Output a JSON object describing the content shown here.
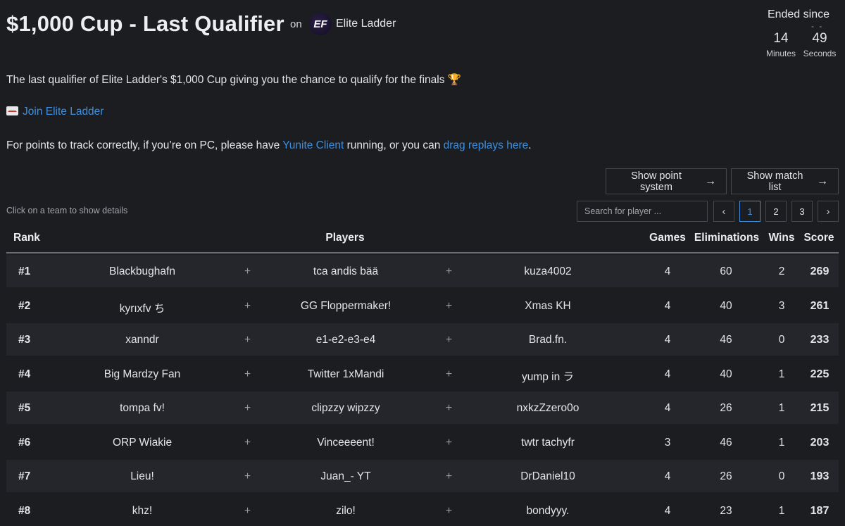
{
  "header": {
    "title": "$1,000 Cup - Last Qualifier",
    "on_label": "on",
    "org_logo_text": "EF",
    "org_name": "Elite Ladder"
  },
  "timer": {
    "label": "Ended since",
    "dash": "- -",
    "minutes": "14",
    "minutes_label": "Minutes",
    "seconds": "49",
    "seconds_label": "Seconds"
  },
  "description": "The last qualifier of Elite Ladder's $1,000 Cup giving you the chance to qualify for the finals 🏆",
  "join_link": "Join Elite Ladder",
  "points_note": {
    "before": "For points to track correctly, if you’re on PC, please have ",
    "client_link": "Yunite Client",
    "middle": " running, or you can ",
    "replays_link": "drag replays here",
    "after": "."
  },
  "buttons": {
    "point_system": "Show point system",
    "match_list": "Show match list",
    "arrow": "→"
  },
  "hint": "Click on a team to show details",
  "search": {
    "placeholder": "Search for player ..."
  },
  "pagination": {
    "prev": "‹",
    "pages": [
      "1",
      "2",
      "3"
    ],
    "active_page": "1",
    "next": "›"
  },
  "table": {
    "headers": {
      "rank": "Rank",
      "players": "Players",
      "games": "Games",
      "eliminations": "Eliminations",
      "wins": "Wins",
      "score": "Score"
    },
    "plus": "+",
    "rows": [
      {
        "rank": "#1",
        "p1": "Blackbughafn",
        "p2": "tca andis bää",
        "p3": "kuza4002",
        "games": "4",
        "eliminations": "60",
        "wins": "2",
        "score": "269"
      },
      {
        "rank": "#2",
        "p1": "kyrıxfv ち",
        "p2": "GG Floppermaker!",
        "p3": "Xmas KH",
        "games": "4",
        "eliminations": "40",
        "wins": "3",
        "score": "261"
      },
      {
        "rank": "#3",
        "p1": "xanndr",
        "p2": "e1-e2-e3-e4",
        "p3": "Brad.fn.",
        "games": "4",
        "eliminations": "46",
        "wins": "0",
        "score": "233"
      },
      {
        "rank": "#4",
        "p1": "Big Mardzy Fan",
        "p2": "Twitter 1xMandi",
        "p3": "yump in ラ",
        "games": "4",
        "eliminations": "40",
        "wins": "1",
        "score": "225"
      },
      {
        "rank": "#5",
        "p1": "tompa fv!",
        "p2": "clipzzy wipzzy",
        "p3": "nxkzZzero0o",
        "games": "4",
        "eliminations": "26",
        "wins": "1",
        "score": "215"
      },
      {
        "rank": "#6",
        "p1": "ORP Wiakie",
        "p2": "Vinceeeent!",
        "p3": "twtr tachyfr",
        "games": "3",
        "eliminations": "46",
        "wins": "1",
        "score": "203"
      },
      {
        "rank": "#7",
        "p1": "Lieu!",
        "p2": "Juan_- YT",
        "p3": "DrDaniel10",
        "games": "4",
        "eliminations": "26",
        "wins": "0",
        "score": "193"
      },
      {
        "rank": "#8",
        "p1": "khz!",
        "p2": "zilo!",
        "p3": "bondyyy.",
        "games": "4",
        "eliminations": "23",
        "wins": "1",
        "score": "187"
      }
    ]
  }
}
